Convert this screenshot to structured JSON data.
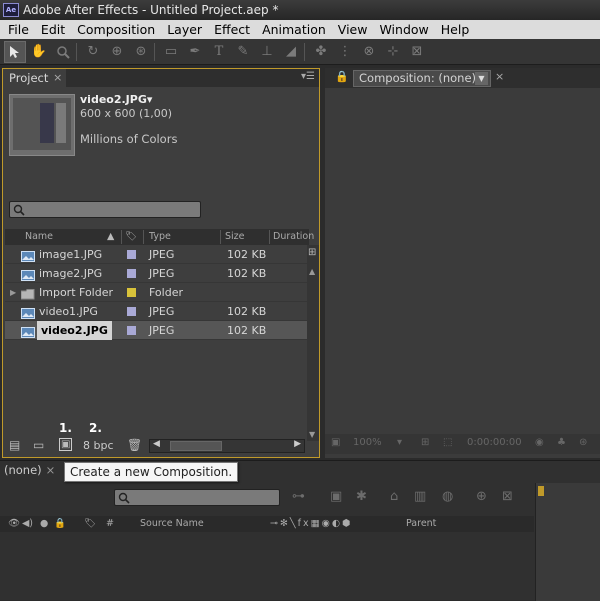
{
  "window": {
    "app_logo": "Ae",
    "title": "Adobe After Effects - Untitled Project.aep *"
  },
  "menubar": {
    "items": [
      "File",
      "Edit",
      "Composition",
      "Layer",
      "Effect",
      "Animation",
      "View",
      "Window",
      "Help"
    ]
  },
  "toolbar": {
    "tools": [
      "selection-tool-icon",
      "hand-tool-icon",
      "zoom-tool-icon",
      "rotate-tool-icon",
      "camera-tool-icon",
      "rectangle-tool-icon",
      "pen-tool-icon",
      "type-tool-icon",
      "brush-tool-icon",
      "eraser-tool-icon",
      "puppet-tool-icon",
      "axis-icon"
    ]
  },
  "project": {
    "tab_label": "Project",
    "tab_close": "×",
    "preview": {
      "name": "video2.JPG▾",
      "dimensions": "600 x 600 (1,00)",
      "colors": "Millions of Colors"
    },
    "columns": {
      "name": "Name",
      "type": "Type",
      "size": "Size",
      "duration": "Duration"
    },
    "files": [
      {
        "name": "image1.JPG",
        "type": "JPEG",
        "size": "102 KB",
        "kind": "image",
        "label_color": "#a9a9d6",
        "selected": false
      },
      {
        "name": "image2.JPG",
        "type": "JPEG",
        "size": "102 KB",
        "kind": "image",
        "label_color": "#a9a9d6",
        "selected": false
      },
      {
        "name": "Import Folder",
        "type": "Folder",
        "size": "",
        "kind": "folder",
        "label_color": "#d8c23a",
        "selected": false
      },
      {
        "name": "video1.JPG",
        "type": "JPEG",
        "size": "102 KB",
        "kind": "image",
        "label_color": "#a9a9d6",
        "selected": false
      },
      {
        "name": "video2.JPG",
        "type": "JPEG",
        "size": "102 KB",
        "kind": "image",
        "label_color": "#a9a9d6",
        "selected": true
      }
    ],
    "footer": {
      "bpc": "8 bpc",
      "annotation_1": "1.",
      "annotation_2": "2."
    }
  },
  "composition": {
    "tab_label": "Composition: (none)",
    "tab_close": "×",
    "zoom": "100%",
    "timecode": "0:00:00:00"
  },
  "timeline": {
    "tab_label": "(none)",
    "tab_close": "×",
    "tooltip": "Create a new Composition.",
    "columns": {
      "number": "#",
      "source_name": "Source Name",
      "parent": "Parent"
    }
  },
  "colors": {
    "panel_highlight": "#c09a2a",
    "label_lavender": "#a9a9d6",
    "label_yellow": "#d8c23a"
  }
}
